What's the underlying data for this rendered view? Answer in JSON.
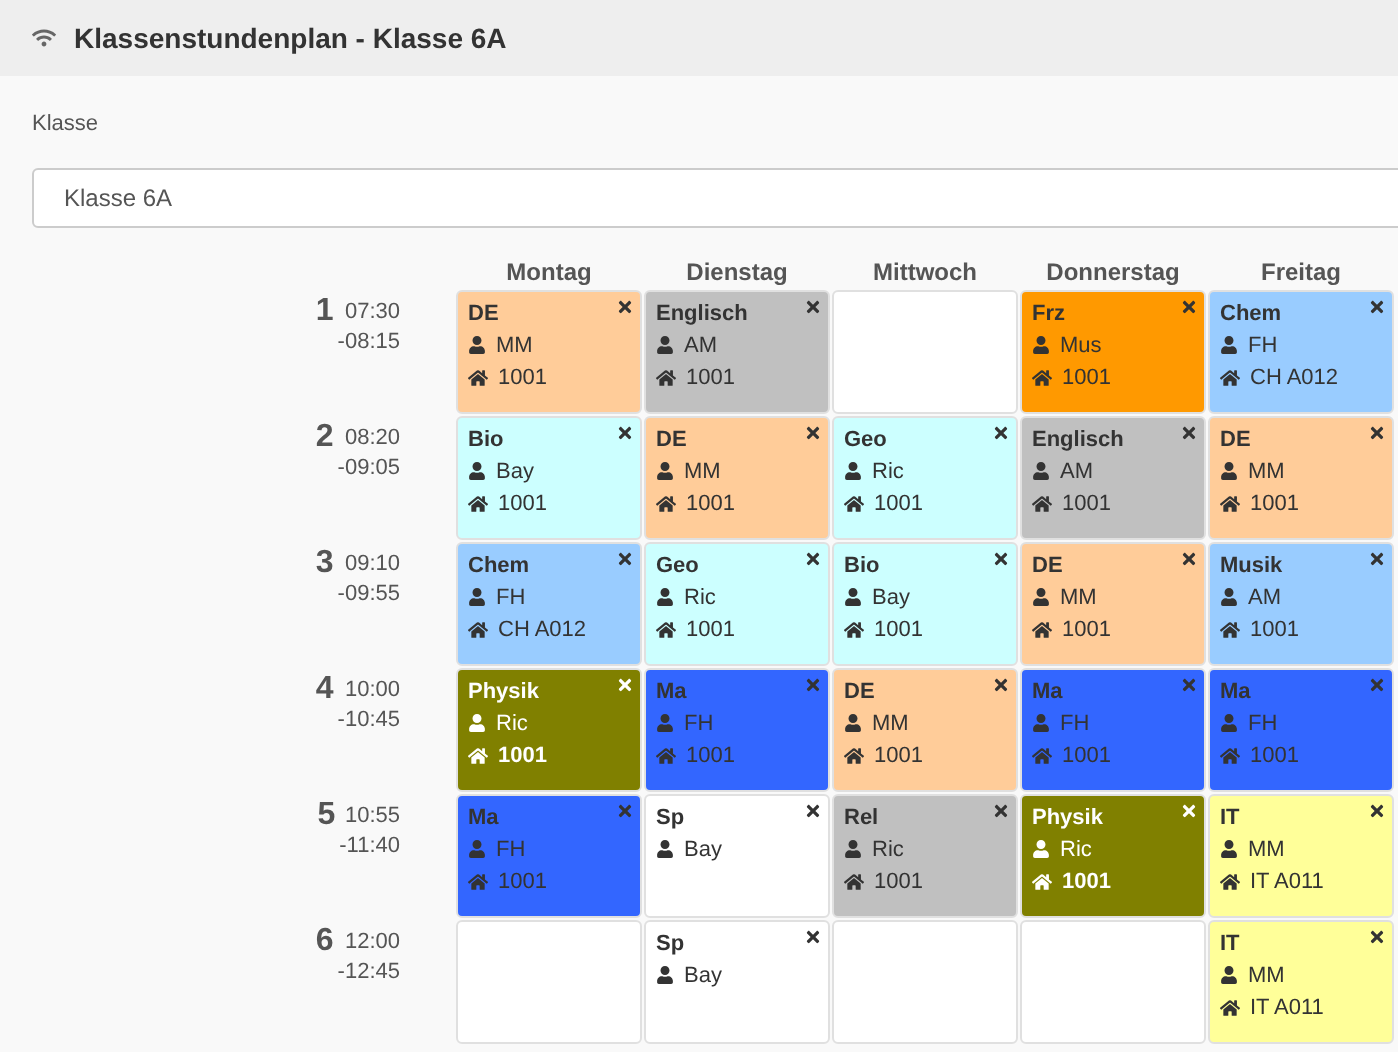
{
  "header": {
    "title": "Klassenstundenplan - Klasse 6A"
  },
  "class_select": {
    "label": "Klasse",
    "value": "Klasse 6A"
  },
  "days": [
    "Montag",
    "Dienstag",
    "Mittwoch",
    "Donnerstag",
    "Freitag"
  ],
  "periods": [
    {
      "number": "1",
      "start": "07:30",
      "end": "-08:15",
      "cells": [
        {
          "kind": "lesson",
          "subject": "DE",
          "teacher": "MM",
          "room": "1001",
          "color": "#ffcc99",
          "inverted": false
        },
        {
          "kind": "lesson",
          "subject": "Englisch",
          "teacher": "AM",
          "room": "1001",
          "color": "#c0c0c0",
          "inverted": false
        },
        {
          "kind": "empty"
        },
        {
          "kind": "lesson",
          "subject": "Frz",
          "teacher": "Mus",
          "room": "1001",
          "color": "#ff9900",
          "inverted": false
        },
        {
          "kind": "lesson",
          "subject": "Chem",
          "teacher": "FH",
          "room": "CH A012",
          "color": "#99ccff",
          "inverted": false
        }
      ]
    },
    {
      "number": "2",
      "start": "08:20",
      "end": "-09:05",
      "cells": [
        {
          "kind": "lesson",
          "subject": "Bio",
          "teacher": "Bay",
          "room": "1001",
          "color": "#ccffff",
          "inverted": false
        },
        {
          "kind": "lesson",
          "subject": "DE",
          "teacher": "MM",
          "room": "1001",
          "color": "#ffcc99",
          "inverted": false
        },
        {
          "kind": "lesson",
          "subject": "Geo",
          "teacher": "Ric",
          "room": "1001",
          "color": "#ccffff",
          "inverted": false
        },
        {
          "kind": "lesson",
          "subject": "Englisch",
          "teacher": "AM",
          "room": "1001",
          "color": "#c0c0c0",
          "inverted": false
        },
        {
          "kind": "lesson",
          "subject": "DE",
          "teacher": "MM",
          "room": "1001",
          "color": "#ffcc99",
          "inverted": false
        }
      ]
    },
    {
      "number": "3",
      "start": "09:10",
      "end": "-09:55",
      "cells": [
        {
          "kind": "lesson",
          "subject": "Chem",
          "teacher": "FH",
          "room": "CH A012",
          "color": "#99ccff",
          "inverted": false
        },
        {
          "kind": "lesson",
          "subject": "Geo",
          "teacher": "Ric",
          "room": "1001",
          "color": "#ccffff",
          "inverted": false
        },
        {
          "kind": "lesson",
          "subject": "Bio",
          "teacher": "Bay",
          "room": "1001",
          "color": "#ccffff",
          "inverted": false
        },
        {
          "kind": "lesson",
          "subject": "DE",
          "teacher": "MM",
          "room": "1001",
          "color": "#ffcc99",
          "inverted": false
        },
        {
          "kind": "lesson",
          "subject": "Musik",
          "teacher": "AM",
          "room": "1001",
          "color": "#99ccff",
          "inverted": false
        }
      ]
    },
    {
      "number": "4",
      "start": "10:00",
      "end": "-10:45",
      "cells": [
        {
          "kind": "lesson",
          "subject": "Physik",
          "teacher": "Ric",
          "room": "1001",
          "color": "#808000",
          "inverted": true
        },
        {
          "kind": "lesson",
          "subject": "Ma",
          "teacher": "FH",
          "room": "1001",
          "color": "#3366ff",
          "inverted": false
        },
        {
          "kind": "lesson",
          "subject": "DE",
          "teacher": "MM",
          "room": "1001",
          "color": "#ffcc99",
          "inverted": false
        },
        {
          "kind": "lesson",
          "subject": "Ma",
          "teacher": "FH",
          "room": "1001",
          "color": "#3366ff",
          "inverted": false
        },
        {
          "kind": "lesson",
          "subject": "Ma",
          "teacher": "FH",
          "room": "1001",
          "color": "#3366ff",
          "inverted": false
        }
      ]
    },
    {
      "number": "5",
      "start": "10:55",
      "end": "-11:40",
      "cells": [
        {
          "kind": "lesson",
          "subject": "Ma",
          "teacher": "FH",
          "room": "1001",
          "color": "#3366ff",
          "inverted": false
        },
        {
          "kind": "lesson",
          "subject": "Sp",
          "teacher": "Bay",
          "color": "#ffffff",
          "inverted": false
        },
        {
          "kind": "lesson",
          "subject": "Rel",
          "teacher": "Ric",
          "room": "1001",
          "color": "#c0c0c0",
          "inverted": false
        },
        {
          "kind": "lesson",
          "subject": "Physik",
          "teacher": "Ric",
          "room": "1001",
          "color": "#808000",
          "inverted": true
        },
        {
          "kind": "lesson",
          "subject": "IT",
          "teacher": "MM",
          "room": "IT A011",
          "color": "#ffff99",
          "inverted": false
        }
      ]
    },
    {
      "number": "6",
      "start": "12:00",
      "end": "-12:45",
      "cells": [
        {
          "kind": "empty"
        },
        {
          "kind": "lesson",
          "subject": "Sp",
          "teacher": "Bay",
          "color": "#ffffff",
          "inverted": false
        },
        {
          "kind": "empty"
        },
        {
          "kind": "empty"
        },
        {
          "kind": "lesson",
          "subject": "IT",
          "teacher": "MM",
          "room": "IT A011",
          "color": "#ffff99",
          "inverted": false
        }
      ]
    }
  ]
}
